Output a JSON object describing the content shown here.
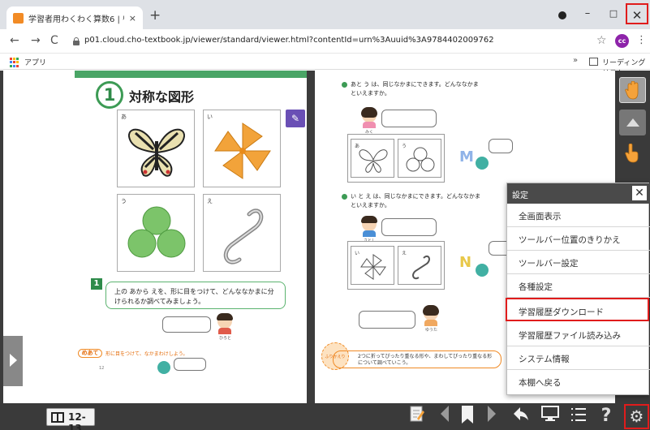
{
  "browser": {
    "tab_title": "学習者用わくわく算数6 | 啓林館デジタル教科書ライブ...",
    "tab_close": "×",
    "new_tab": "+",
    "win_min": "–",
    "win_max": "□",
    "win_close": "✕",
    "nav_back": "←",
    "nav_forward": "→",
    "nav_reload": "C",
    "url": "p01.cloud.cho-textbook.jp/viewer/standard/viewer.html?contentId=urn%3Auuid%3A9784402009762",
    "star": "☆",
    "profile_initials": "cc",
    "kebab": "⋮",
    "apps_label": "アプリ",
    "bookmarks_more": "»",
    "reading_list": "リーディング リスト"
  },
  "textbook": {
    "section_number": "1",
    "section_title": "対称な図形",
    "figure_labels": [
      "あ",
      "い",
      "う",
      "え"
    ],
    "question1_number": "1",
    "question1_text": "上の あから えを、形に目をつけて、どんななかまに分けられるか調べてみましょう。",
    "meate_label": "めあて",
    "meate_text": "形に目をつけて、なかまわけしよう。",
    "page_number": "12",
    "right_q1": "あと う は、同じなかまにできます。どんななかまといえますか。",
    "right_q2": "い と え は、同じなかまにできます。どんななかまといえますか。",
    "kid_name_1": "みく",
    "kid_name_2": "さとし",
    "kid_name_3": "ゆうた",
    "kid_name_4": "ひろと",
    "letter_m": "M",
    "letter_n": "N",
    "footnote_badge": "ふりかえり",
    "footnote_text": "2つに折ってぴったり重なる形や、まわしてぴったり重なる形について調べていこう。"
  },
  "settings_menu": {
    "title": "設定",
    "close": "✕",
    "items": [
      "全画面表示",
      "ツールバー位置のきりかえ",
      "ツールバー設定",
      "各種設定",
      "学習履歴ダウンロード",
      "学習履歴ファイル読み込み",
      "システム情報",
      "本棚へ戻る"
    ],
    "highlighted_item": "学習履歴ダウンロード"
  },
  "bottom_bar": {
    "page_range": "12-13",
    "icons": [
      "note-icon",
      "prev-page-icon",
      "bookmark-icon",
      "next-page-icon",
      "back-arrow-icon",
      "screen-icon",
      "list-icon",
      "help-icon",
      "gear-icon"
    ],
    "help": "?",
    "gear": "⚙"
  },
  "colors": {
    "highlight_red": "#e01c1c",
    "textbook_green": "#3d9b55",
    "toolbar_dark": "#3a3a3a",
    "profile_purple": "#8e24aa"
  }
}
